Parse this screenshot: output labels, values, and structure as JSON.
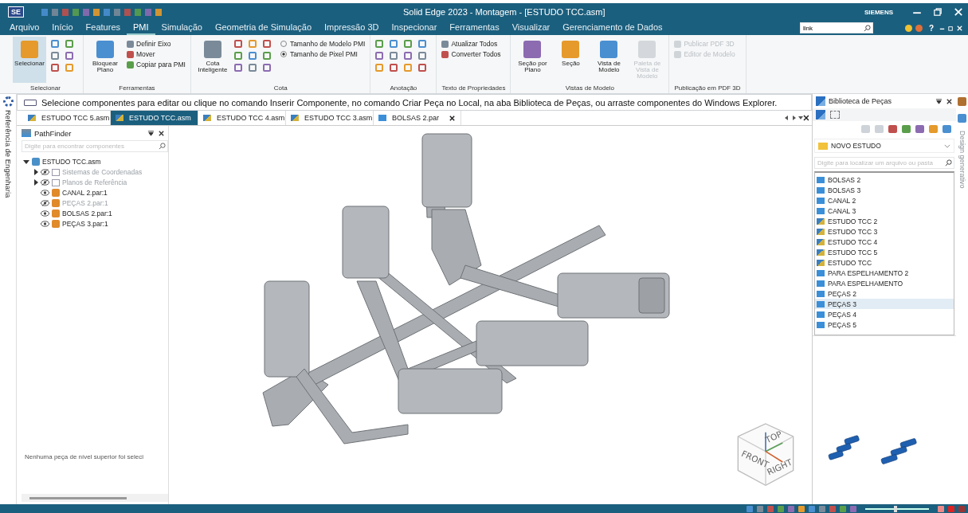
{
  "app": {
    "logo": "SE",
    "title": "Solid Edge 2023 - Montagem - [ESTUDO TCC.asm]",
    "brand": "SIEMENS",
    "help": "?"
  },
  "menu": [
    {
      "label": "Arquivo",
      "selected": false
    },
    {
      "label": "Início",
      "selected": false
    },
    {
      "label": "Features",
      "selected": false
    },
    {
      "label": "PMI",
      "selected": true
    },
    {
      "label": "Simulação",
      "selected": false
    },
    {
      "label": "Geometria de Simulação",
      "selected": false
    },
    {
      "label": "Impressão 3D",
      "selected": false
    },
    {
      "label": "Inspecionar",
      "selected": false
    },
    {
      "label": "Ferramentas",
      "selected": false
    },
    {
      "label": "Visualizar",
      "selected": false
    },
    {
      "label": "Gerenciamento de Dados",
      "selected": false
    }
  ],
  "search": {
    "value": "link"
  },
  "ribbon": [
    {
      "label": "Selecionar",
      "large": [
        {
          "label": "Selecionar",
          "selected": true,
          "disabled": false
        }
      ]
    },
    {
      "label": "Ferramentas",
      "large": [
        {
          "label": "Bloquear Plano",
          "selected": false,
          "disabled": false
        }
      ],
      "small": [
        {
          "label": "Definir Eixo",
          "disabled": false
        },
        {
          "label": "Mover",
          "disabled": false
        },
        {
          "label": "Copiar para PMI",
          "disabled": false
        }
      ]
    },
    {
      "label": "Cota",
      "large": [
        {
          "label": "Cota Inteligente",
          "selected": false,
          "disabled": false
        }
      ],
      "radios": [
        {
          "label": "Tamanho de Modelo PMI",
          "selected": false
        },
        {
          "label": "Tamanho de Pixel PMI",
          "selected": true
        }
      ]
    },
    {
      "label": "Anotação"
    },
    {
      "label": "Texto de Propriedades",
      "small": [
        {
          "label": "Atualizar Todos",
          "disabled": false
        },
        {
          "label": "Converter Todos",
          "disabled": false
        }
      ]
    },
    {
      "label": "Vistas de Modelo",
      "large": [
        {
          "label": "Seção por Plano",
          "selected": false,
          "disabled": false
        },
        {
          "label": "Seção",
          "selected": false,
          "disabled": false
        },
        {
          "label": "Vista de Modelo",
          "selected": false,
          "disabled": false
        },
        {
          "label": "Paleta de Vista de Modelo",
          "selected": false,
          "disabled": true
        }
      ]
    },
    {
      "label": "Publicação em PDF 3D",
      "small": [
        {
          "label": "Publicar PDF 3D",
          "disabled": true
        },
        {
          "label": "Editor de Modelo",
          "disabled": true
        }
      ]
    }
  ],
  "prompt": "Selecione componentes para editar ou clique no comando Inserir Componente, no comando Criar Peça no Local, na aba Biblioteca de Peças, ou arraste componentes do Windows Explorer.",
  "left_strip": "Referência de Engenharia",
  "doc_tabs": [
    {
      "label": "ESTUDO TCC 5.asm",
      "selected": false,
      "kind": "assembly"
    },
    {
      "label": "ESTUDO TCC.asm",
      "selected": true,
      "kind": "assembly"
    },
    {
      "label": "ESTUDO TCC 4.asm",
      "selected": false,
      "kind": "assembly"
    },
    {
      "label": "ESTUDO TCC 3.asm",
      "selected": false,
      "kind": "assembly"
    },
    {
      "label": "BOLSAS 2.par",
      "selected": false,
      "kind": "part"
    }
  ],
  "pathfinder": {
    "title": "PathFinder",
    "search_placeholder": "Digite para encontrar componentes",
    "tree": {
      "label": "ESTUDO TCC.asm",
      "expanded": true,
      "children": [
        {
          "label": "Sistemas de Coordenadas",
          "kind": "folder",
          "expanded": false,
          "visible": false
        },
        {
          "label": "Planos de Referência",
          "kind": "folder",
          "expanded": false,
          "visible": false
        },
        {
          "label": "CANAL 2.par:1",
          "kind": "part",
          "visible": true
        },
        {
          "label": "PEÇAS 2.par:1",
          "kind": "part",
          "visible": false
        },
        {
          "label": "BOLSAS 2.par:1",
          "kind": "part",
          "visible": true
        },
        {
          "label": "PEÇAS 3.par:1",
          "kind": "part",
          "visible": true
        }
      ]
    },
    "message": "Nenhuma peça de nível superior foi seleci"
  },
  "view_cube": {
    "top": "TOP",
    "front": "FRONT",
    "right": "RIGHT"
  },
  "library": {
    "title": "Biblioteca de Peças",
    "folder": "NOVO ESTUDO",
    "search_placeholder": "Digite para localizar um arquivo ou pasta",
    "items": [
      {
        "label": "BOLSAS 2",
        "kind": "part",
        "selected": false
      },
      {
        "label": "BOLSAS 3",
        "kind": "part",
        "selected": false
      },
      {
        "label": "CANAL 2",
        "kind": "part",
        "selected": false
      },
      {
        "label": "CANAL 3",
        "kind": "part",
        "selected": false
      },
      {
        "label": "ESTUDO TCC 2",
        "kind": "assembly",
        "selected": false
      },
      {
        "label": "ESTUDO TCC 3",
        "kind": "assembly",
        "selected": false
      },
      {
        "label": "ESTUDO TCC 4",
        "kind": "assembly",
        "selected": false
      },
      {
        "label": "ESTUDO TCC 5",
        "kind": "assembly",
        "selected": false
      },
      {
        "label": "ESTUDO TCC",
        "kind": "assembly",
        "selected": false
      },
      {
        "label": "PARA ESPELHAMENTO 2",
        "kind": "part",
        "selected": false
      },
      {
        "label": "PARA ESPELHAMENTO",
        "kind": "part",
        "selected": false
      },
      {
        "label": "PEÇAS 2",
        "kind": "part",
        "selected": false
      },
      {
        "label": "PEÇAS 3",
        "kind": "part",
        "selected": true
      },
      {
        "label": "PEÇAS 4",
        "kind": "part",
        "selected": false
      },
      {
        "label": "PEÇAS 5",
        "kind": "part",
        "selected": false
      }
    ]
  },
  "far_strip": "Design generativo",
  "status": {
    "zoom_slider": {
      "level": 0.45
    }
  }
}
